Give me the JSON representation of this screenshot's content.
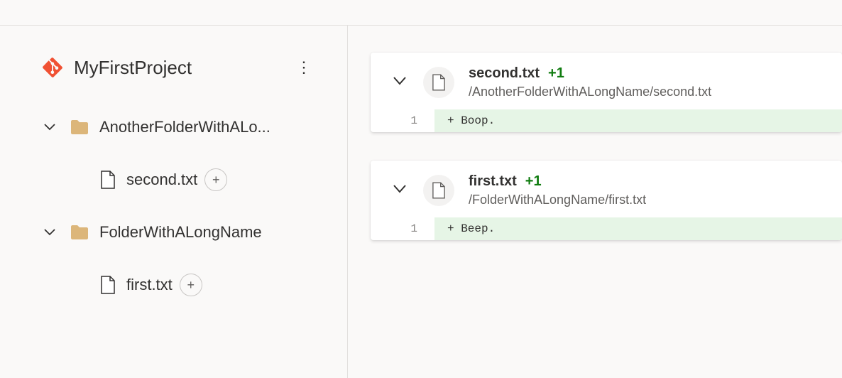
{
  "project": {
    "title": "MyFirstProject"
  },
  "tree": {
    "folders": [
      {
        "label": "AnotherFolderWithALo...",
        "file": {
          "label": "second.txt",
          "badge": "+"
        }
      },
      {
        "label": "FolderWithALongName",
        "file": {
          "label": "first.txt",
          "badge": "+"
        }
      }
    ]
  },
  "diffs": [
    {
      "filename": "second.txt",
      "change": "+1",
      "path": "/AnotherFolderWithALongName/second.txt",
      "line_no": "1",
      "line": "+ Boop."
    },
    {
      "filename": "first.txt",
      "change": "+1",
      "path": "/FolderWithALongName/first.txt",
      "line_no": "1",
      "line": "+ Beep."
    }
  ]
}
